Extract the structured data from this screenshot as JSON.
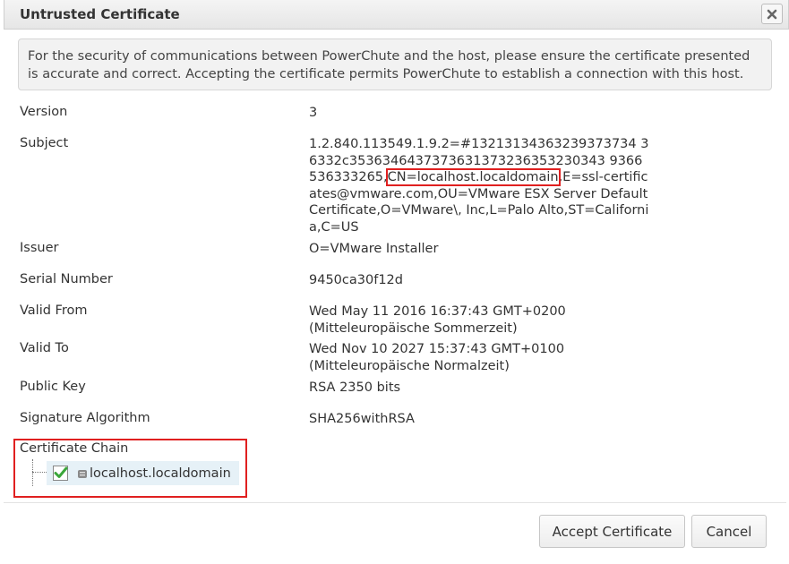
{
  "dialog": {
    "title": "Untrusted Certificate",
    "notice": "For the security of communications between PowerChute and the host, please ensure the certificate presented is accurate and correct. Accepting the certificate permits PowerChute to establish a connection with this host."
  },
  "fields": {
    "version": {
      "label": "Version",
      "value": "3"
    },
    "subject": {
      "label": "Subject",
      "value_part1": "1.2.840.113549.1.9.2=#13213134363239373734 36332c3536346437373631373236353230343 9366536333265,",
      "value_highlight": "CN=localhost.localdomain",
      "value_part2": ",E=ssl-certificates@vmware.com,OU=VMware ESX Server Default Certificate,O=VMware\\, Inc,L=Palo Alto,ST=California,C=US"
    },
    "issuer": {
      "label": "Issuer",
      "value": "O=VMware Installer"
    },
    "serial": {
      "label": "Serial Number",
      "value": "9450ca30f12d"
    },
    "valid_from": {
      "label": "Valid From",
      "value": "Wed May 11 2016 16:37:43 GMT+0200",
      "value2": "(Mitteleuropäische Sommerzeit)"
    },
    "valid_to": {
      "label": "Valid To",
      "value": "Wed Nov 10 2027 15:37:43 GMT+0100",
      "value2": "(Mitteleuropäische Normalzeit)"
    },
    "public_key": {
      "label": "Public Key",
      "value": "RSA 2350 bits"
    },
    "signature": {
      "label": "Signature Algorithm",
      "value": "SHA256withRSA"
    }
  },
  "chain": {
    "label": "Certificate Chain",
    "node_label": "localhost.localdomain",
    "node_checked": true
  },
  "buttons": {
    "accept": "Accept Certificate",
    "cancel": "Cancel"
  },
  "colors": {
    "highlight": "#e02020",
    "check": "#3aa63a"
  }
}
